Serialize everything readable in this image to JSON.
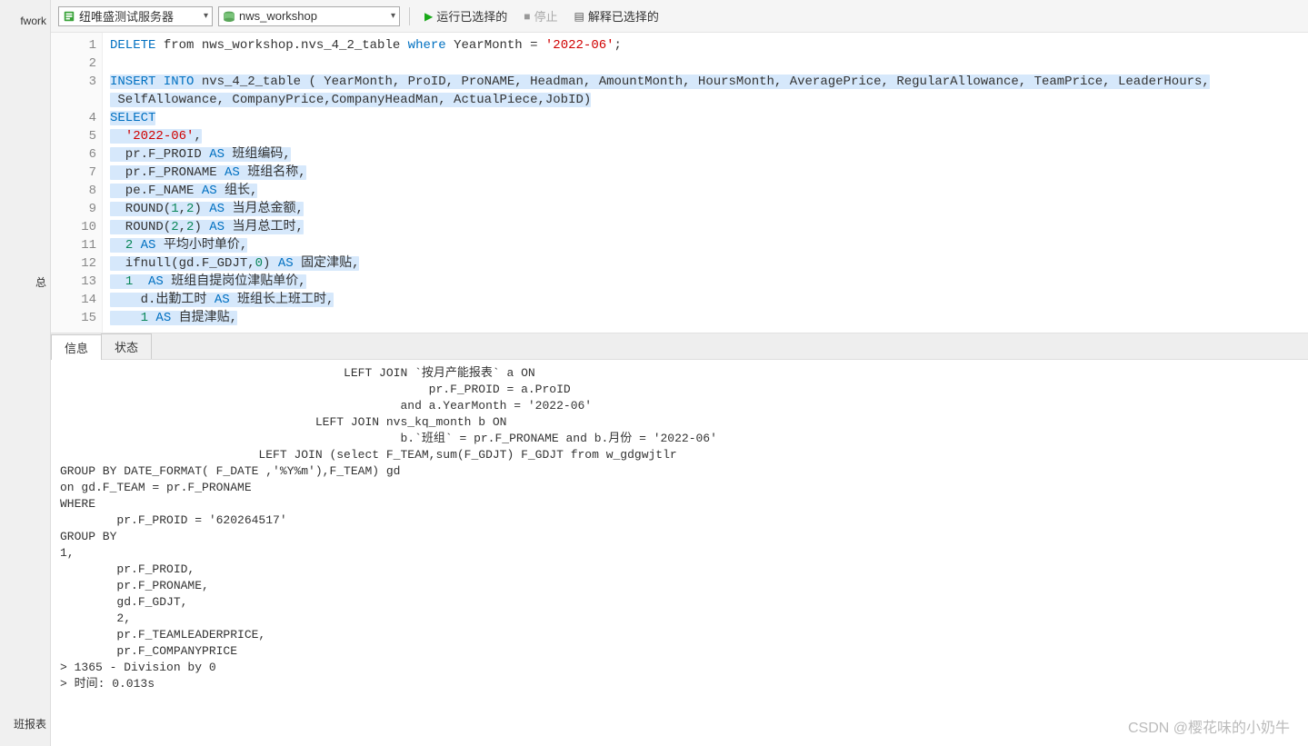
{
  "sidebar": {
    "items": [
      "fwork",
      "总",
      "班报表"
    ]
  },
  "toolbar": {
    "connection_label": "纽唯盛测试服务器",
    "database_label": "nws_workshop",
    "run_label": "运行已选择的",
    "stop_label": "停止",
    "explain_label": "解释已选择的"
  },
  "editor": {
    "lines": [
      {
        "n": "1",
        "segments": [
          {
            "t": "DELETE",
            "c": "kw"
          },
          {
            "t": " from nws_workshop.nvs_4_2_table ",
            "c": "ident"
          },
          {
            "t": "where",
            "c": "kw"
          },
          {
            "t": " YearMonth = ",
            "c": "ident"
          },
          {
            "t": "'2022-06'",
            "c": "str"
          },
          {
            "t": ";",
            "c": "ident"
          }
        ]
      },
      {
        "n": "2",
        "segments": []
      },
      {
        "n": "3",
        "selected": true,
        "segments": [
          {
            "t": "INSERT INTO",
            "c": "kw"
          },
          {
            "t": " nvs_4_2_table ( YearMonth, ProID, ProNAME, Headman, AmountMonth, HoursMonth, AveragePrice, RegularAllowance, TeamPrice, LeaderHours,",
            "c": "ident"
          }
        ]
      },
      {
        "n": "",
        "selected": true,
        "segments": [
          {
            "t": " SelfAllowance, CompanyPrice,CompanyHeadMan, ActualPiece,JobID)",
            "c": "ident"
          }
        ]
      },
      {
        "n": "4",
        "selected": true,
        "segments": [
          {
            "t": "SELECT",
            "c": "kw"
          }
        ]
      },
      {
        "n": "5",
        "selected": true,
        "segments": [
          {
            "t": "  ",
            "c": "ident"
          },
          {
            "t": "'2022-06'",
            "c": "str"
          },
          {
            "t": ",",
            "c": "ident"
          }
        ]
      },
      {
        "n": "6",
        "selected": true,
        "segments": [
          {
            "t": "  pr.F_PROID ",
            "c": "ident"
          },
          {
            "t": "AS",
            "c": "kw"
          },
          {
            "t": " 班组编码,",
            "c": "ident"
          }
        ]
      },
      {
        "n": "7",
        "selected": true,
        "segments": [
          {
            "t": "  pr.F_PRONAME ",
            "c": "ident"
          },
          {
            "t": "AS",
            "c": "kw"
          },
          {
            "t": " 班组名称,",
            "c": "ident"
          }
        ]
      },
      {
        "n": "8",
        "selected": true,
        "segments": [
          {
            "t": "  pe.F_NAME ",
            "c": "ident"
          },
          {
            "t": "AS",
            "c": "kw"
          },
          {
            "t": " 组长,",
            "c": "ident"
          }
        ]
      },
      {
        "n": "9",
        "selected": true,
        "segments": [
          {
            "t": "  ROUND(",
            "c": "ident"
          },
          {
            "t": "1",
            "c": "num"
          },
          {
            "t": ",",
            "c": "ident"
          },
          {
            "t": "2",
            "c": "num"
          },
          {
            "t": ") ",
            "c": "ident"
          },
          {
            "t": "AS",
            "c": "kw"
          },
          {
            "t": " 当月总金额,",
            "c": "ident"
          }
        ]
      },
      {
        "n": "10",
        "selected": true,
        "segments": [
          {
            "t": "  ROUND(",
            "c": "ident"
          },
          {
            "t": "2",
            "c": "num"
          },
          {
            "t": ",",
            "c": "ident"
          },
          {
            "t": "2",
            "c": "num"
          },
          {
            "t": ") ",
            "c": "ident"
          },
          {
            "t": "AS",
            "c": "kw"
          },
          {
            "t": " 当月总工时,",
            "c": "ident"
          }
        ]
      },
      {
        "n": "11",
        "selected": true,
        "segments": [
          {
            "t": "  ",
            "c": "ident"
          },
          {
            "t": "2",
            "c": "num"
          },
          {
            "t": " ",
            "c": "ident"
          },
          {
            "t": "AS",
            "c": "kw"
          },
          {
            "t": " 平均小时单价,",
            "c": "ident"
          }
        ]
      },
      {
        "n": "12",
        "selected": true,
        "segments": [
          {
            "t": "  ifnull(gd.F_GDJT,",
            "c": "ident"
          },
          {
            "t": "0",
            "c": "num"
          },
          {
            "t": ") ",
            "c": "ident"
          },
          {
            "t": "AS",
            "c": "kw"
          },
          {
            "t": " 固定津贴,",
            "c": "ident"
          }
        ]
      },
      {
        "n": "13",
        "selected": true,
        "segments": [
          {
            "t": "  ",
            "c": "ident"
          },
          {
            "t": "1",
            "c": "num"
          },
          {
            "t": "  ",
            "c": "ident"
          },
          {
            "t": "AS",
            "c": "kw"
          },
          {
            "t": " 班组自提岗位津贴单价,",
            "c": "ident"
          }
        ]
      },
      {
        "n": "14",
        "selected": true,
        "segments": [
          {
            "t": "    d.出勤工时 ",
            "c": "ident"
          },
          {
            "t": "AS",
            "c": "kw"
          },
          {
            "t": " 班组长上班工时,",
            "c": "ident"
          }
        ]
      },
      {
        "n": "15",
        "selected": true,
        "segments": [
          {
            "t": "    ",
            "c": "ident"
          },
          {
            "t": "1",
            "c": "num"
          },
          {
            "t": " ",
            "c": "ident"
          },
          {
            "t": "AS",
            "c": "kw"
          },
          {
            "t": " 自提津贴,",
            "c": "ident"
          }
        ]
      }
    ]
  },
  "tabs": {
    "info": "信息",
    "status": "状态"
  },
  "output_text": "                                        LEFT JOIN `按月产能报表` a ON\n                                                    pr.F_PROID = a.ProID\n                                                and a.YearMonth = '2022-06'\n                                    LEFT JOIN nvs_kq_month b ON\n                                                b.`班组` = pr.F_PRONAME and b.月份 = '2022-06'\n                            LEFT JOIN (select F_TEAM,sum(F_GDJT) F_GDJT from w_gdgwjtlr\nGROUP BY DATE_FORMAT( F_DATE ,'%Y%m'),F_TEAM) gd\non gd.F_TEAM = pr.F_PRONAME\nWHERE\n        pr.F_PROID = '620264517'\nGROUP BY\n1,\n        pr.F_PROID,\n        pr.F_PRONAME,\n        gd.F_GDJT,\n        2,\n        pr.F_TEAMLEADERPRICE,\n        pr.F_COMPANYPRICE\n> 1365 - Division by 0\n> 时间: 0.013s",
  "watermark": "CSDN @樱花味的小奶牛"
}
